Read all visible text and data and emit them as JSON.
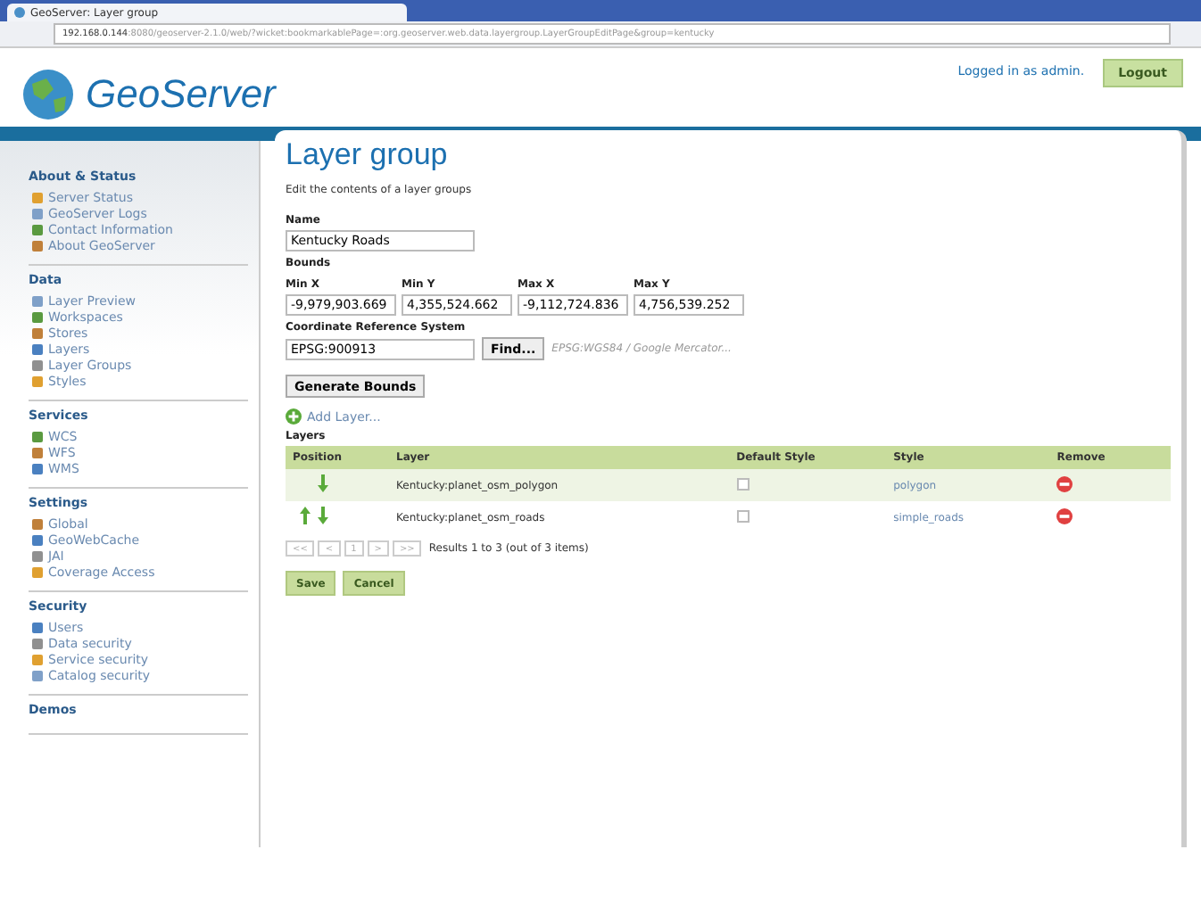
{
  "browser": {
    "tab_title": "GeoServer: Layer group",
    "url_host": "192.168.0.144",
    "url_rest": ":8080/geoserver-2.1.0/web/?wicket:bookmarkablePage=:org.geoserver.web.data.layergroup.LayerGroupEditPage&group=kentucky"
  },
  "header": {
    "logo_text": "GeoServer",
    "login_text": "Logged in as admin.",
    "logout_label": "Logout"
  },
  "sidebar": [
    {
      "title": "About & Status",
      "items": [
        "Server Status",
        "GeoServer Logs",
        "Contact Information",
        "About GeoServer"
      ]
    },
    {
      "title": "Data",
      "items": [
        "Layer Preview",
        "Workspaces",
        "Stores",
        "Layers",
        "Layer Groups",
        "Styles"
      ]
    },
    {
      "title": "Services",
      "items": [
        "WCS",
        "WFS",
        "WMS"
      ]
    },
    {
      "title": "Settings",
      "items": [
        "Global",
        "GeoWebCache",
        "JAI",
        "Coverage Access"
      ]
    },
    {
      "title": "Security",
      "items": [
        "Users",
        "Data security",
        "Service security",
        "Catalog security"
      ]
    },
    {
      "title": "Demos"
    }
  ],
  "page": {
    "title": "Layer group",
    "description": "Edit the contents of a layer groups",
    "name_label": "Name",
    "name_value": "Kentucky Roads",
    "bounds_label": "Bounds",
    "bounds": [
      {
        "label": "Min X",
        "value": "-9,979,903.669"
      },
      {
        "label": "Min Y",
        "value": "4,355,524.662"
      },
      {
        "label": "Max X",
        "value": "-9,112,724.836"
      },
      {
        "label": "Max Y",
        "value": "4,756,539.252"
      }
    ],
    "crs_label": "Coordinate Reference System",
    "crs_value": "EPSG:900913",
    "find_label": "Find...",
    "crs_description": "EPSG:WGS84 / Google Mercator...",
    "generate_label": "Generate Bounds",
    "add_layer_label": "Add Layer...",
    "layers_label": "Layers",
    "table": {
      "columns": [
        "Position",
        "Layer",
        "Default Style",
        "Style",
        "Remove"
      ],
      "rows": [
        {
          "can_move_up": false,
          "can_move_down": true,
          "layer": "Kentucky:planet_osm_polygon",
          "default_style": false,
          "style": "polygon"
        },
        {
          "can_move_up": true,
          "can_move_down": true,
          "layer": "Kentucky:planet_osm_roads",
          "default_style": false,
          "style": "simple_roads"
        }
      ]
    },
    "pager": [
      "<<",
      "<",
      "1",
      ">",
      ">>"
    ],
    "results_text": "Results 1 to 3 (out of 3 items)",
    "save_label": "Save",
    "cancel_label": "Cancel"
  }
}
